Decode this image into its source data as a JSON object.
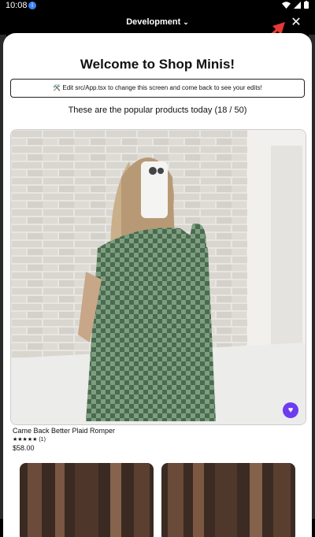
{
  "status_bar": {
    "time": "10:08",
    "notification_badge": "i"
  },
  "header": {
    "title": "Development"
  },
  "sheet": {
    "title": "Welcome to Shop Minis!",
    "edit_hint": "🛠️ Edit src/App.tsx to change this screen and come back to see your edits!",
    "popular_text": "These are the popular products today (18 / 50)"
  },
  "product": {
    "name": "Came Back Better Plaid Romper",
    "stars": "★★★★★",
    "review_count": "(1)",
    "price": "$58.00"
  },
  "colors": {
    "accent": "#6d3bf0",
    "annotation_arrow": "#e53935"
  }
}
